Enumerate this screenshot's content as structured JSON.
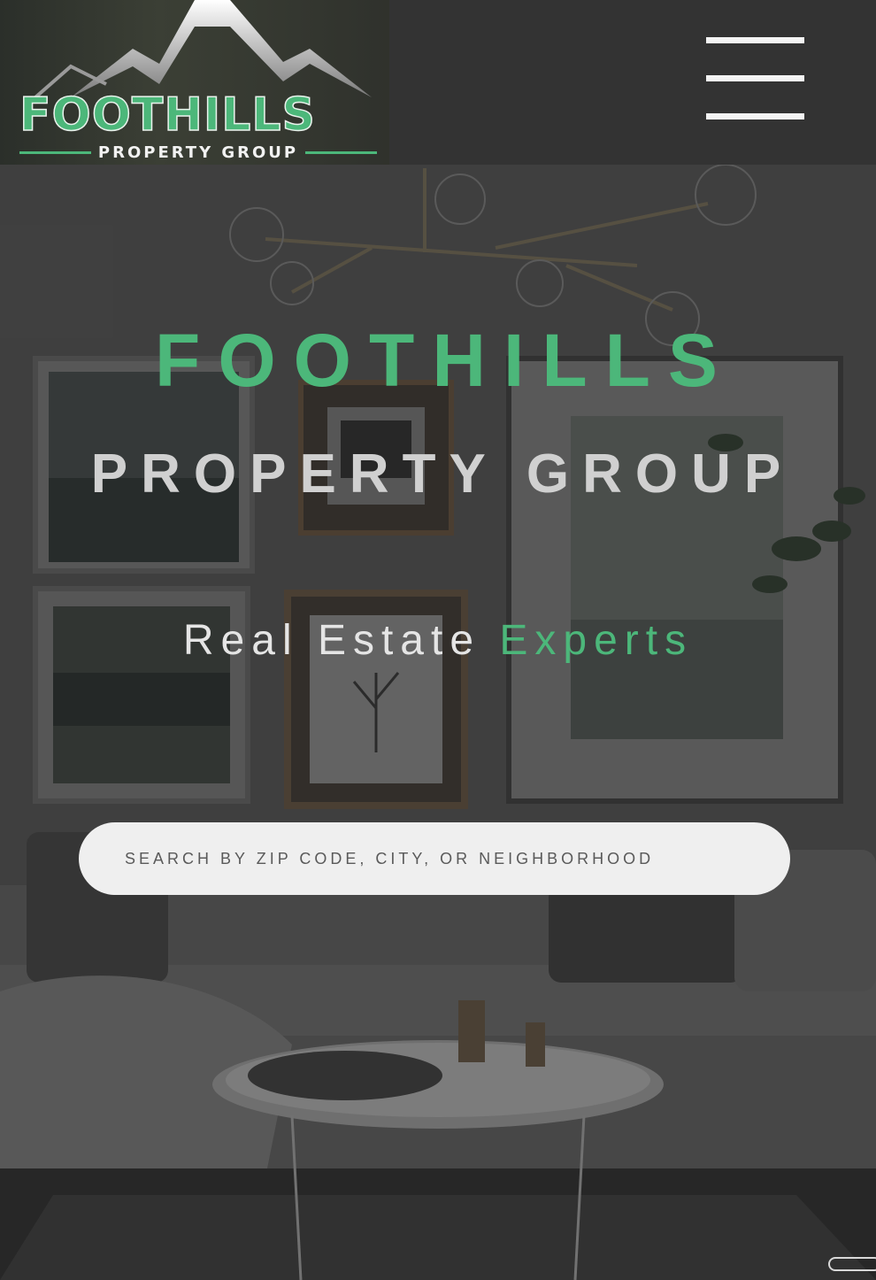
{
  "header": {
    "logo": {
      "wordmark": "FOOTHILLS",
      "subtext": "PROPERTY GROUP"
    },
    "menu_icon": "hamburger-icon"
  },
  "hero": {
    "title": "FOOTHILLS",
    "subtitle": "PROPERTY GROUP",
    "tagline_part1": "Real Estate",
    "tagline_part2": "Experts"
  },
  "search": {
    "placeholder": "SEARCH BY ZIP CODE, CITY, OR NEIGHBORHOOD",
    "value": ""
  },
  "colors": {
    "brand_green": "#4cb77a",
    "header_bg": "#333333",
    "search_bg": "#efefef"
  }
}
